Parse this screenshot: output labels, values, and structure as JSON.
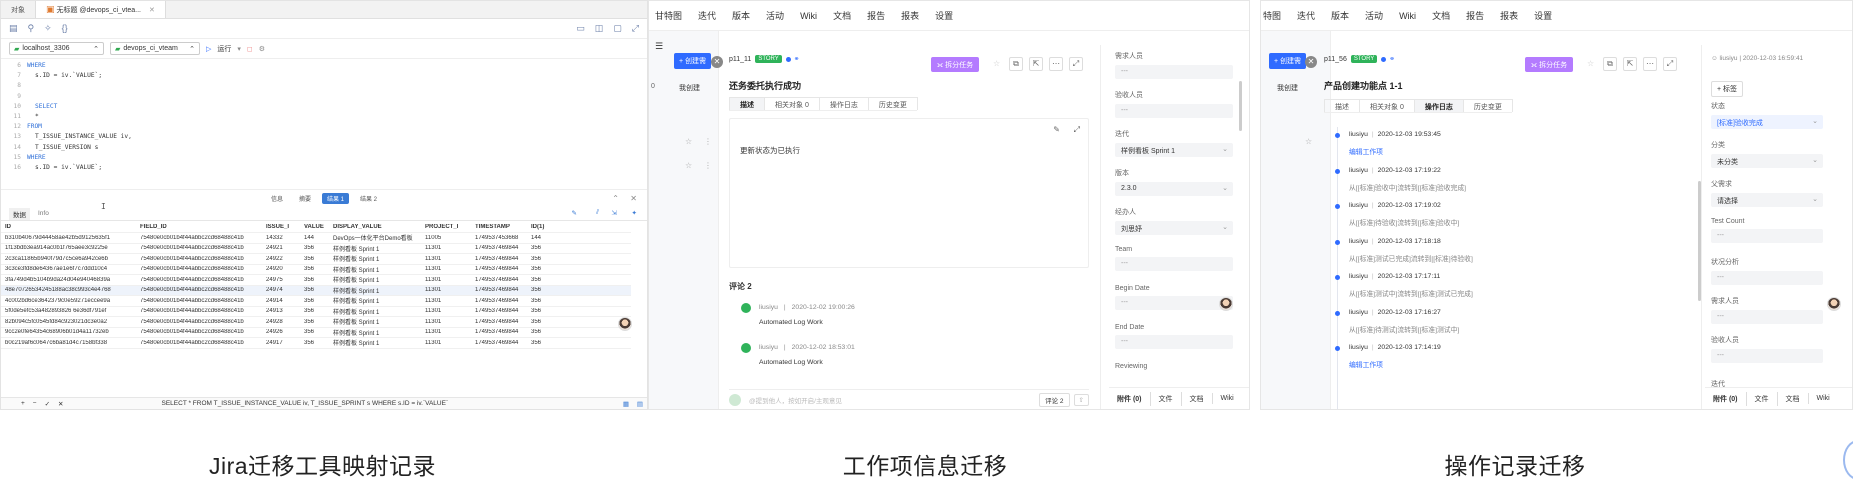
{
  "panel1": {
    "tabs": [
      "对象",
      "无标题 @devops_ci_vtea..."
    ],
    "connection": "localhost_3306",
    "database": "devops_ci_vteam",
    "run_label": "运行",
    "code_lines": [
      {
        "n": "6",
        "t": "WHERE",
        "kw": true,
        "indent": 0
      },
      {
        "n": "7",
        "t": "s.ID = iv.`VALUE`;",
        "kw": false,
        "indent": 1
      },
      {
        "n": "8",
        "t": "",
        "kw": false,
        "indent": 0
      },
      {
        "n": "9",
        "t": "",
        "kw": false,
        "indent": 0
      },
      {
        "n": "10",
        "t": "SELECT",
        "kw": true,
        "indent": 1
      },
      {
        "n": "11",
        "t": "*",
        "kw": false,
        "indent": 1
      },
      {
        "n": "12",
        "t": "FROM",
        "kw": true,
        "indent": 0
      },
      {
        "n": "13",
        "t": "T_ISSUE_INSTANCE_VALUE iv,",
        "kw": false,
        "indent": 1
      },
      {
        "n": "14",
        "t": "T_ISSUE_VERSION s",
        "kw": false,
        "indent": 1
      },
      {
        "n": "15",
        "t": "WHERE",
        "kw": true,
        "indent": 0
      },
      {
        "n": "16",
        "t": "s.ID = iv.`VALUE`;",
        "kw": false,
        "indent": 1
      }
    ],
    "result_tabs": [
      "信息",
      "摘要",
      "结果 1",
      "结果 2"
    ],
    "result_active": 2,
    "sub_tabs": [
      "数据",
      "Info"
    ],
    "columns": [
      "ID",
      "FIELD_ID",
      "ISSUE_I",
      "VALUE",
      "DISPLAY_VALUE",
      "PROJECT_I",
      "TIMESTAMP",
      "ID(1)"
    ],
    "rows": [
      [
        "b310b40679d44458ae42b5d9125635f1",
        "75480e0cb01b4f44abbc2cd68488c41b",
        "14332",
        "144",
        "DevOps一体化平台Demo看板",
        "11005",
        "1749537453668",
        "144"
      ],
      [
        "1f13bdb3ea914ac0b1f765aee3c9225e",
        "75480e0cb01b4f44abbc2cd68488c41b",
        "24921",
        "356",
        "样例看板 Sprint 1",
        "11301",
        "1749537469844",
        "356"
      ],
      [
        "2c3ca11865b940f79d7c5ce6a942ce6b",
        "75480e0cb01b4f44abbc2cd68488c41b",
        "24922",
        "356",
        "样例看板 Sprint 1",
        "11301",
        "1749537469844",
        "356"
      ],
      [
        "3c3ce3fd8de64367ae1e6f7c7ddd10c4",
        "75480e0cb01b4f44abbc2cd68488c41b",
        "24920",
        "356",
        "样例看板 Sprint 1",
        "11301",
        "1749537469844",
        "356"
      ],
      [
        "3fa749d4b5104b9da24d04e94046839a",
        "75480e0cb01b4f44abbc2cd68488c41b",
        "24975",
        "356",
        "样例看板 Sprint 1",
        "11301",
        "1749537469844",
        "356"
      ],
      [
        "48e70726534245188ac38c993c4e4768",
        "75480e0cb01b4f44abbc2cd68488c41b",
        "24974",
        "356",
        "样例看板 Sprint 1",
        "11301",
        "1749537469844",
        "356"
      ],
      [
        "4c002bd6ce3642379c0e59271eccee9a",
        "75480e0cb01b4f44abbc2cd68488c41b",
        "24914",
        "356",
        "样例看板 Sprint 1",
        "11301",
        "1749537469844",
        "356"
      ],
      [
        "5f0de5efc53a482893826 6e36df791ef",
        "75480e0cb01b4f44abbc2cd68488c41b",
        "24913",
        "356",
        "样例看板 Sprint 1",
        "11301",
        "1749537469844",
        "356"
      ],
      [
        "82b094c5fc0545fd84c923021dc3e0a2",
        "75480e0cb01b4f44abbc2cd68488c41b",
        "24928",
        "356",
        "样例看板 Sprint 1",
        "11301",
        "1749537469844",
        "356"
      ],
      [
        "9cc2e0fe64354c68906b01d4a11732eb",
        "75480e0cb01b4f44abbc2cd68488c41b",
        "24926",
        "356",
        "样例看板 Sprint 1",
        "11301",
        "1749537469844",
        "356"
      ],
      [
        "b0c219af6c0647c6ba81d4c7158bf338",
        "75480e0cb01b4f44abbc2cd68488c41b",
        "24917",
        "356",
        "样例看板 Sprint 1",
        "11301",
        "1749537469844",
        "356"
      ]
    ],
    "status_sql": "SELECT * FROM T_ISSUE_INSTANCE_VALUE iv, T_ISSUE_SPRINT s WHERE s.ID = iv.`VALUE`"
  },
  "panel2": {
    "nav": [
      "甘特图",
      "迭代",
      "版本",
      "活动",
      "Wiki",
      "文档",
      "报告",
      "报表",
      "设置"
    ],
    "create_label": "+ 创建需",
    "left_label": "我创建",
    "issue_key": "p11_11",
    "story": "STORY",
    "split_label": "拆分任务",
    "title": "还务委托执行成功",
    "tabs": [
      "描述",
      "相关对象 0",
      "操作日志",
      "历史变更"
    ],
    "active_tab": 0,
    "description": "更新状态为已执行",
    "comments_title": "评论 2",
    "comments": [
      {
        "user": "liusiyu",
        "time": "2020-12-02 19:00:26",
        "text": "Automated Log Work"
      },
      {
        "user": "liusiyu",
        "time": "2020-12-02 18:53:01",
        "text": "Automated Log Work"
      }
    ],
    "comment_placeholder": "@提到他人，按如开启/主观意见",
    "comment_count": "评论 2",
    "fields": [
      {
        "label": "需求人员",
        "value": "---"
      },
      {
        "label": "验收人员",
        "value": "---"
      },
      {
        "label": "迭代",
        "value": "样例看板 Sprint 1"
      },
      {
        "label": "版本",
        "value": "2.3.0"
      },
      {
        "label": "经办人",
        "value": "刘思妤"
      },
      {
        "label": "Team",
        "value": "---"
      },
      {
        "label": "Begin Date",
        "value": "---"
      },
      {
        "label": "End Date",
        "value": "---"
      },
      {
        "label": "Reviewing",
        "value": ""
      }
    ],
    "bottom": [
      "附件 (0)",
      "文件",
      "文档",
      "Wiki"
    ]
  },
  "panel3": {
    "nav": [
      "特图",
      "迭代",
      "版本",
      "活动",
      "Wiki",
      "文档",
      "报告",
      "报表",
      "设置"
    ],
    "create_label": "+ 创建需",
    "left_label": "我创建",
    "issue_key": "p11_56",
    "story": "STORY",
    "split_label": "拆分任务",
    "title": "产品创建功能点 1-1",
    "tabs": [
      "描述",
      "相关对象 0",
      "操作日志",
      "历史变更"
    ],
    "active_tab": 2,
    "logs": [
      {
        "user": "liusiyu",
        "time": "2020-12-03 19:53:45",
        "desc": "编辑工作项",
        "link": true
      },
      {
        "user": "liusiyu",
        "time": "2020-12-03 17:19:22",
        "desc": "从[[标准]验收中]流转到[[标准]验收完成]",
        "link": false
      },
      {
        "user": "liusiyu",
        "time": "2020-12-03 17:19:02",
        "desc": "从[[标准]待验收]流转到[[标准]验收中]",
        "link": false
      },
      {
        "user": "liusiyu",
        "time": "2020-12-03 17:18:18",
        "desc": "从[[标准]测试已完成]流转到[[标准]待验收]",
        "link": false
      },
      {
        "user": "liusiyu",
        "time": "2020-12-03 17:17:11",
        "desc": "从[[标准]测试中]流转到[[标准]测试已完成]",
        "link": false
      },
      {
        "user": "liusiyu",
        "time": "2020-12-03 17:16:27",
        "desc": "从[[标准]待测试]流转到[[标准]测试中]",
        "link": false
      },
      {
        "user": "liusiyu",
        "time": "2020-12-03 17:14:19",
        "desc": "编辑工作项",
        "link": true
      }
    ],
    "creator": "liusiyu | 2020-12-03 16:59:41",
    "tag_label": "+ 标签",
    "fields": [
      {
        "label": "状态",
        "value": "[标准]验收完成"
      },
      {
        "label": "分类",
        "value": "未分类"
      },
      {
        "label": "父需求",
        "value": "请选择"
      },
      {
        "label": "Test Count",
        "value": "---"
      },
      {
        "label": "状况分析",
        "value": "---"
      },
      {
        "label": "需求人员",
        "value": "---"
      },
      {
        "label": "验收人员",
        "value": "---"
      }
    ],
    "more_label": "迭代",
    "bottom": [
      "附件 (0)",
      "文件",
      "文档",
      "Wiki"
    ]
  },
  "captions": [
    "Jira迁移工具映射记录",
    "工作项信息迁移",
    "操作记录迁移"
  ]
}
